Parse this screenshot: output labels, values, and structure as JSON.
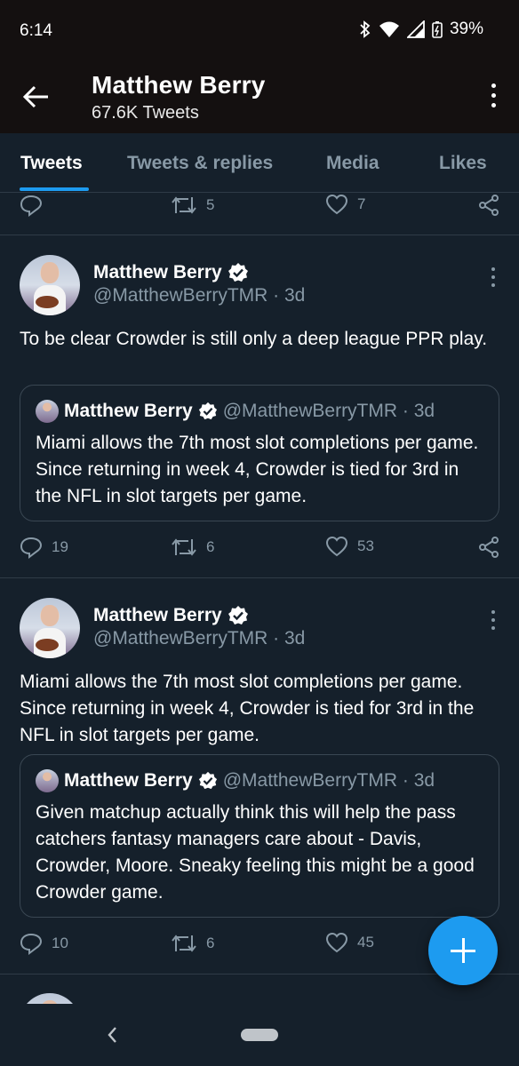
{
  "status": {
    "time": "6:14",
    "battery": "39%"
  },
  "header": {
    "name": "Matthew Berry",
    "tweet_count": "67.6K Tweets"
  },
  "tabs": [
    {
      "label": "Tweets",
      "active": true
    },
    {
      "label": "Tweets & replies",
      "active": false
    },
    {
      "label": "Media",
      "active": false
    },
    {
      "label": "Likes",
      "active": false
    }
  ],
  "partial_tweet": {
    "retweets": "5",
    "likes": "7"
  },
  "tweets": [
    {
      "name": "Matthew Berry",
      "handle": "@MatthewBerryTMR · 3d",
      "text": "To be clear Crowder is still only a deep league PPR play.",
      "quote": {
        "name": "Matthew Berry",
        "handle": "@MatthewBerryTMR · 3d",
        "text": "Miami allows the 7th most slot completions per game. Since returning in week 4, Crowder is tied for 3rd in the NFL in slot targets per game."
      },
      "replies": "19",
      "retweets": "6",
      "likes": "53"
    },
    {
      "name": "Matthew Berry",
      "handle": "@MatthewBerryTMR · 3d",
      "text": "Miami allows the 7th most slot completions per game. Since returning in week 4, Crowder is tied for 3rd in the NFL in slot targets per game.",
      "quote": {
        "name": "Matthew Berry",
        "handle": "@MatthewBerryTMR · 3d",
        "text": "Given matchup actually think this will help the pass catchers fantasy managers care about - Davis, Crowder, Moore. Sneaky feeling this might be a good Crowder game."
      },
      "replies": "10",
      "retweets": "6",
      "likes": "45"
    }
  ],
  "colors": {
    "background": "#15202b",
    "accent": "#1d9bf0",
    "muted": "#8899a6",
    "verified": "#ffffff"
  }
}
